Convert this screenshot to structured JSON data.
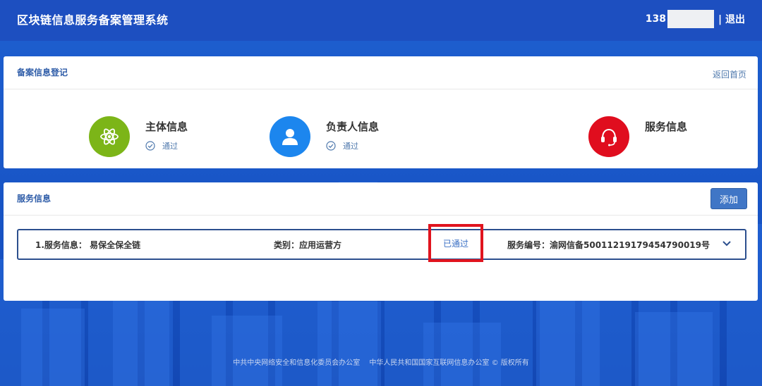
{
  "header": {
    "app_title": "区块链信息服务备案管理系统",
    "phone_prefix": "138",
    "logout_label": "| 退出"
  },
  "registration": {
    "card_title": "备案信息登记",
    "back_home_label": "返回首页",
    "steps": [
      {
        "name": "主体信息",
        "status": "通过",
        "icon": "atom-icon",
        "color": "#7cb518"
      },
      {
        "name": "负责人信息",
        "status": "通过",
        "icon": "user-icon",
        "color": "#1c86ee"
      },
      {
        "name": "服务信息",
        "status": "",
        "icon": "headset-icon",
        "color": "#e00d1e"
      }
    ]
  },
  "services": {
    "card_title": "服务信息",
    "add_label": "添加",
    "rows": [
      {
        "service_info": "1.服务信息：  易保全保全链",
        "category": "类别：应用运营方",
        "status": "已通过",
        "service_number": "服务编号：渝网信备50011219179454790019号"
      }
    ]
  },
  "footer": {
    "org1": "中共中央网络安全和信息化委员会办公室",
    "org2": "中华人民共和国国家互联网信息办公室 © 版权所有"
  },
  "colors": {
    "header_bg": "#1d4fc0",
    "accent": "#2e5ca8",
    "status_highlight": "#e0141e"
  }
}
